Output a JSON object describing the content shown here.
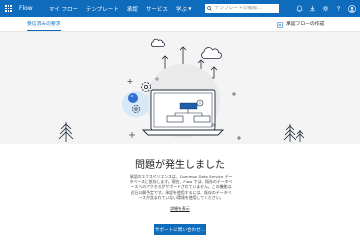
{
  "header": {
    "app_name": "Flow",
    "nav": [
      {
        "label": "マイ フロー",
        "has_caret": false
      },
      {
        "label": "テンプレート",
        "has_caret": false
      },
      {
        "label": "承認",
        "has_caret": false
      },
      {
        "label": "サービス",
        "has_caret": false
      },
      {
        "label": "学ぶ",
        "has_caret": true
      }
    ],
    "search_placeholder": "テンプレートの検索...",
    "bar_color": "#0f6cbd"
  },
  "subbar": {
    "tab_label": "受信済みの要求",
    "create_label": "承認フローの作成"
  },
  "error": {
    "title": "問題が発生しました",
    "message": "承認のエクスペリエンスは、Common Data Service データベースに依存します。現在、Flow では、既存のデータベースへのアクセスがサポートされていません。この機能は近日公開予定です。承認を使用するには、既存のデータベースが含まれていない環境を使用してください。",
    "link": "詳細を表示",
    "button": "サポートに問い合わせ..."
  }
}
